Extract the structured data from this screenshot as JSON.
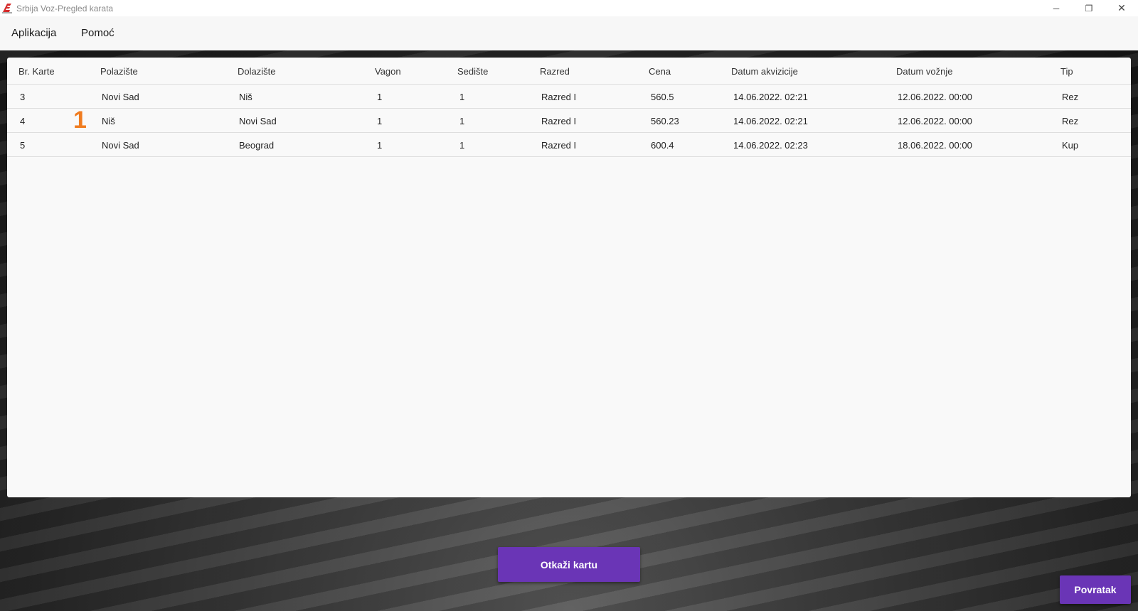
{
  "window": {
    "title": "Srbija Voz-Pregled karata",
    "minimize_glyph": "─",
    "restore_glyph": "❐",
    "close_glyph": "✕"
  },
  "menu": {
    "items": [
      "Aplikacija",
      "Pomoć"
    ]
  },
  "table": {
    "columns": [
      "Br. Karte",
      "Polazište",
      "Dolazište",
      "Vagon",
      "Sedište",
      "Razred",
      "Cena",
      "Datum akvizicije",
      "Datum vožnje",
      "Tip"
    ],
    "rows": [
      [
        "3",
        "Novi Sad",
        "Niš",
        "1",
        "1",
        "Razred I",
        "560.5",
        "14.06.2022. 02:21",
        "12.06.2022. 00:00",
        "Rez"
      ],
      [
        "4",
        "Niš",
        "Novi Sad",
        "1",
        "1",
        "Razred I",
        "560.23",
        "14.06.2022. 02:21",
        "12.06.2022. 00:00",
        "Rez"
      ],
      [
        "5",
        "Novi Sad",
        "Beograd",
        "1",
        "1",
        "Razred I",
        "600.4",
        "14.06.2022. 02:23",
        "18.06.2022. 00:00",
        "Kup"
      ]
    ]
  },
  "annotation_marker": "1",
  "buttons": {
    "cancel_ticket": "Otkaži kartu",
    "back": "Povratak"
  },
  "colors": {
    "accent": "#6a35b6",
    "marker": "#f07c20",
    "app_icon_red": "#d52b2b"
  },
  "icons": [
    "app-logo-icon",
    "minimize-icon",
    "restore-icon",
    "close-icon"
  ]
}
